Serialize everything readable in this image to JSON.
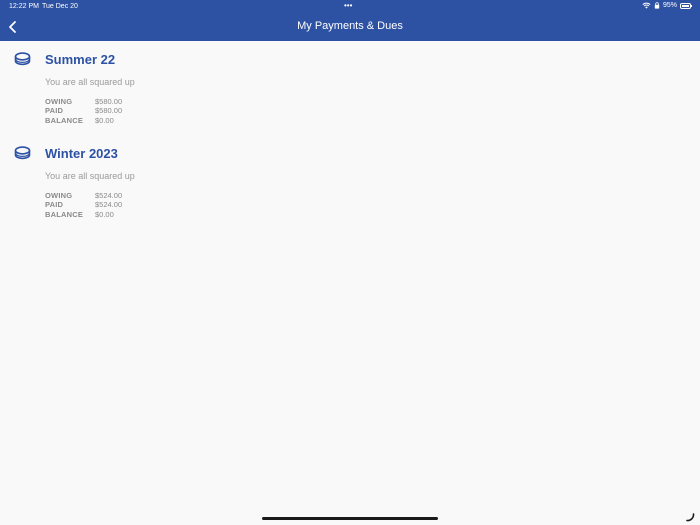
{
  "status_bar": {
    "time": "12:22 PM",
    "date": "Tue Dec 20",
    "dots": "•••",
    "battery": "95%",
    "battery_level": 0.95
  },
  "header": {
    "title": "My Payments & Dues",
    "back_icon": "chevron-left-icon",
    "background": "#2d52a4"
  },
  "seasons": [
    {
      "title": "Summer 22",
      "icon": "coin-stack-icon",
      "status": "You are all squared up",
      "owing_label": "OWING",
      "owing": "$580.00",
      "paid_label": "PAID",
      "paid": "$580.00",
      "balance_label": "BALANCE",
      "balance": "$0.00"
    },
    {
      "title": "Winter 2023",
      "icon": "coin-stack-icon",
      "status": "You are all squared up",
      "owing_label": "OWING",
      "owing": "$524.00",
      "paid_label": "PAID",
      "paid": "$524.00",
      "balance_label": "BALANCE",
      "balance": "$0.00"
    }
  ],
  "colors": {
    "accent": "#2d52a4",
    "muted_text": "#9a9a9a",
    "background": "#f9f9f9"
  }
}
